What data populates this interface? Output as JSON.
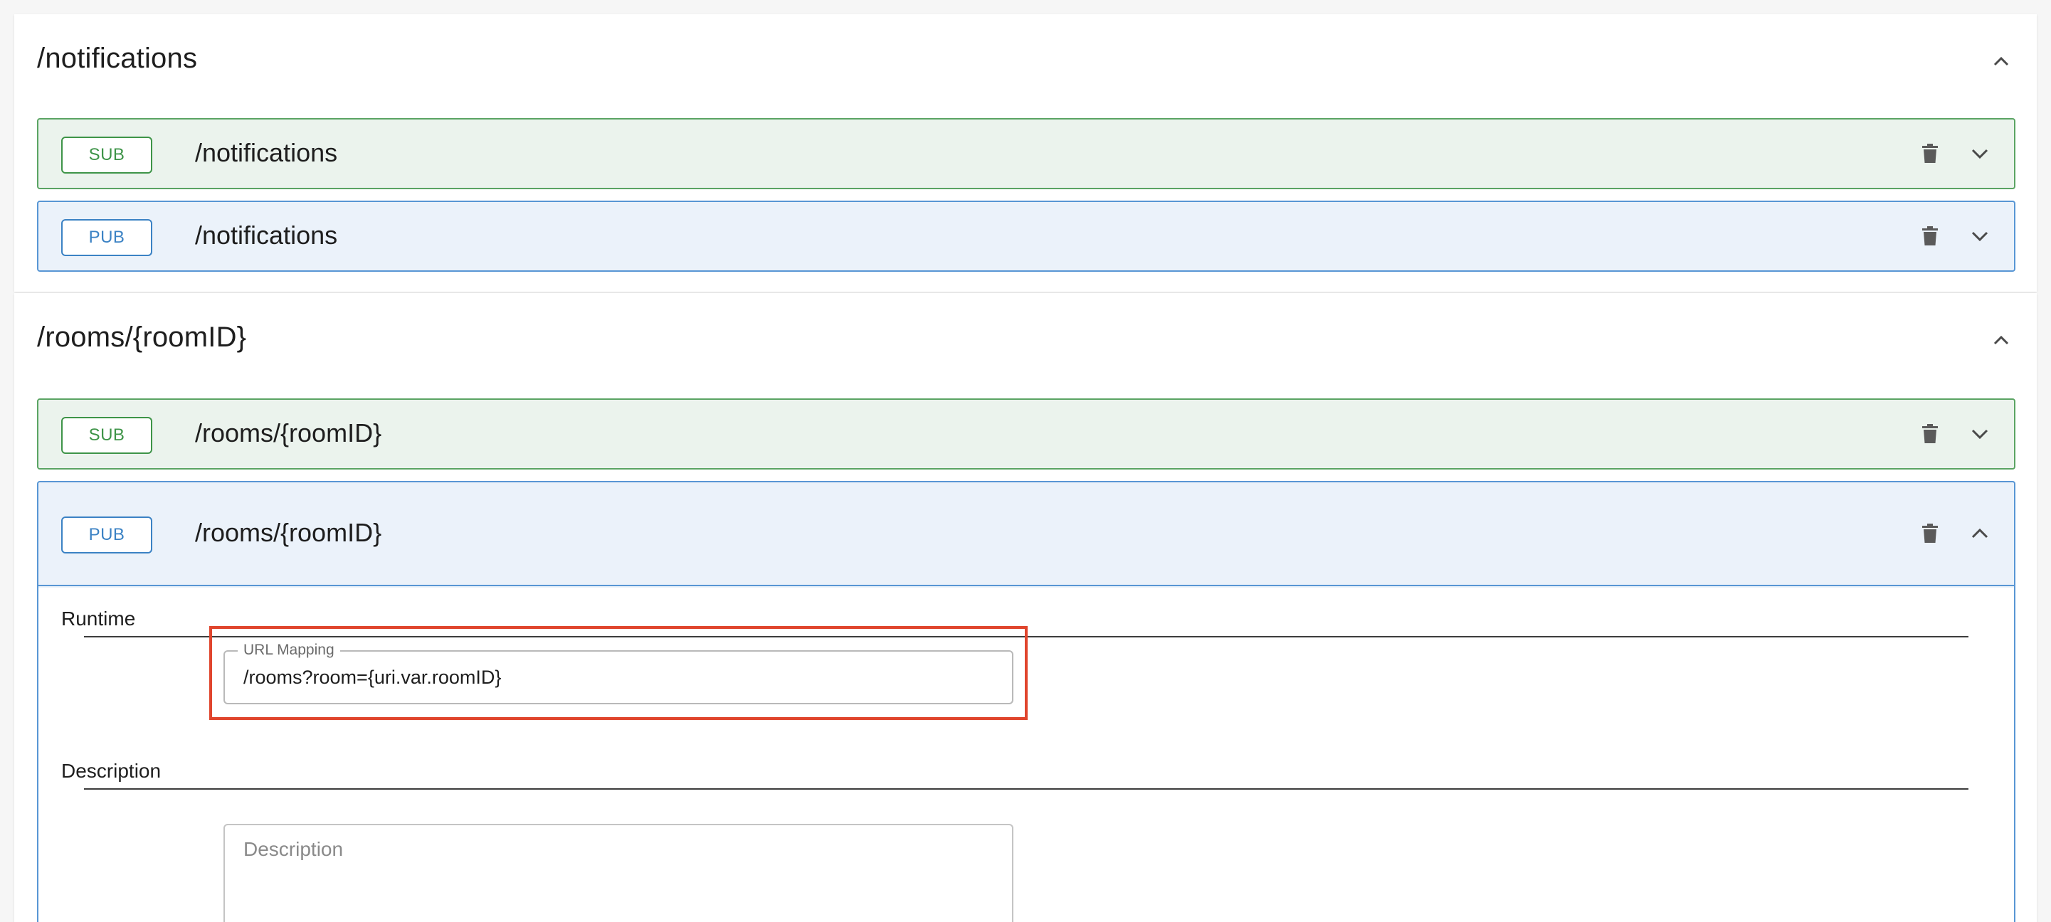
{
  "colors": {
    "sub_bg": "#ebf3ed",
    "sub_border": "#5aa463",
    "pub_bg": "#ebf2fa",
    "pub_border": "#5896d4",
    "highlight": "#e0452d"
  },
  "channels": [
    {
      "title": "/notifications",
      "collapse_icon": "chevron-up-icon",
      "operations": [
        {
          "badge": "SUB",
          "path": "/notifications",
          "delete_icon": "trash-icon",
          "toggle_icon": "chevron-down-icon"
        },
        {
          "badge": "PUB",
          "path": "/notifications",
          "delete_icon": "trash-icon",
          "toggle_icon": "chevron-down-icon"
        }
      ]
    },
    {
      "title": "/rooms/{roomID}",
      "collapse_icon": "chevron-up-icon",
      "operations": [
        {
          "badge": "SUB",
          "path": "/rooms/{roomID}",
          "delete_icon": "trash-icon",
          "toggle_icon": "chevron-down-icon"
        },
        {
          "badge": "PUB",
          "path": "/rooms/{roomID}",
          "delete_icon": "trash-icon",
          "toggle_icon": "chevron-up-icon",
          "expanded": true,
          "runtime": {
            "label": "Runtime",
            "url_mapping": {
              "label": "URL Mapping",
              "value": "/rooms?room={uri.var.roomID}"
            }
          },
          "description": {
            "label": "Description",
            "placeholder": "Description"
          }
        }
      ]
    }
  ]
}
